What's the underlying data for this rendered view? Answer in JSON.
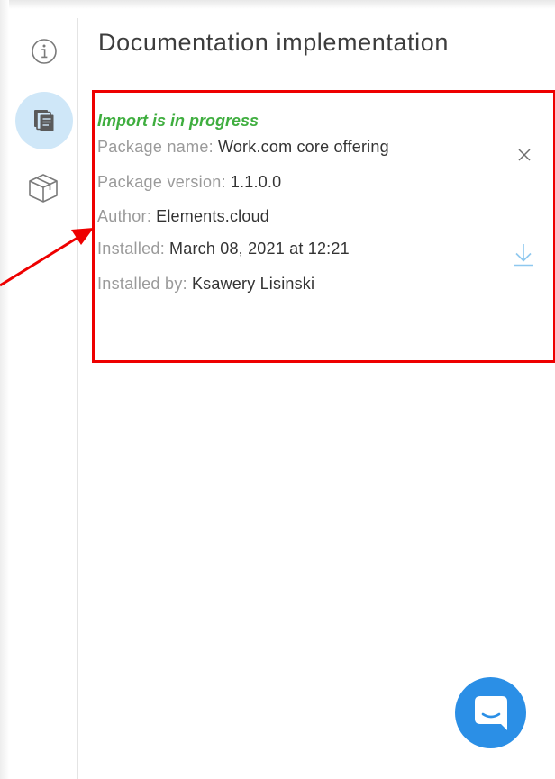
{
  "panel": {
    "title": "Documentation implementation"
  },
  "rail": {
    "items": [
      {
        "icon": "info-icon",
        "active": false
      },
      {
        "icon": "documents-icon",
        "active": true
      },
      {
        "icon": "package-icon",
        "active": false
      }
    ],
    "active_color": "#cfe7f8",
    "icon_color": "#7a7a7a"
  },
  "package": {
    "status": "Import is in progress",
    "status_color": "#3fae3f",
    "rows": [
      {
        "label": "Package name:",
        "value": "Work.com core offering"
      },
      {
        "label": "Package version:",
        "value": "1.1.0.0"
      },
      {
        "label": "Author:",
        "value": "Elements.cloud"
      },
      {
        "label": "Installed:",
        "value": "March 08, 2021 at 12:21"
      },
      {
        "label": "Installed by:",
        "value": "Ksawery Lisinski"
      }
    ],
    "actions": {
      "close_icon": "close-icon",
      "download_icon": "download-icon",
      "download_color": "#8ec8ef"
    }
  },
  "annotation": {
    "highlight_color": "#ee0000"
  },
  "chat": {
    "icon": "chat-icon",
    "color": "#2b8fe6"
  }
}
